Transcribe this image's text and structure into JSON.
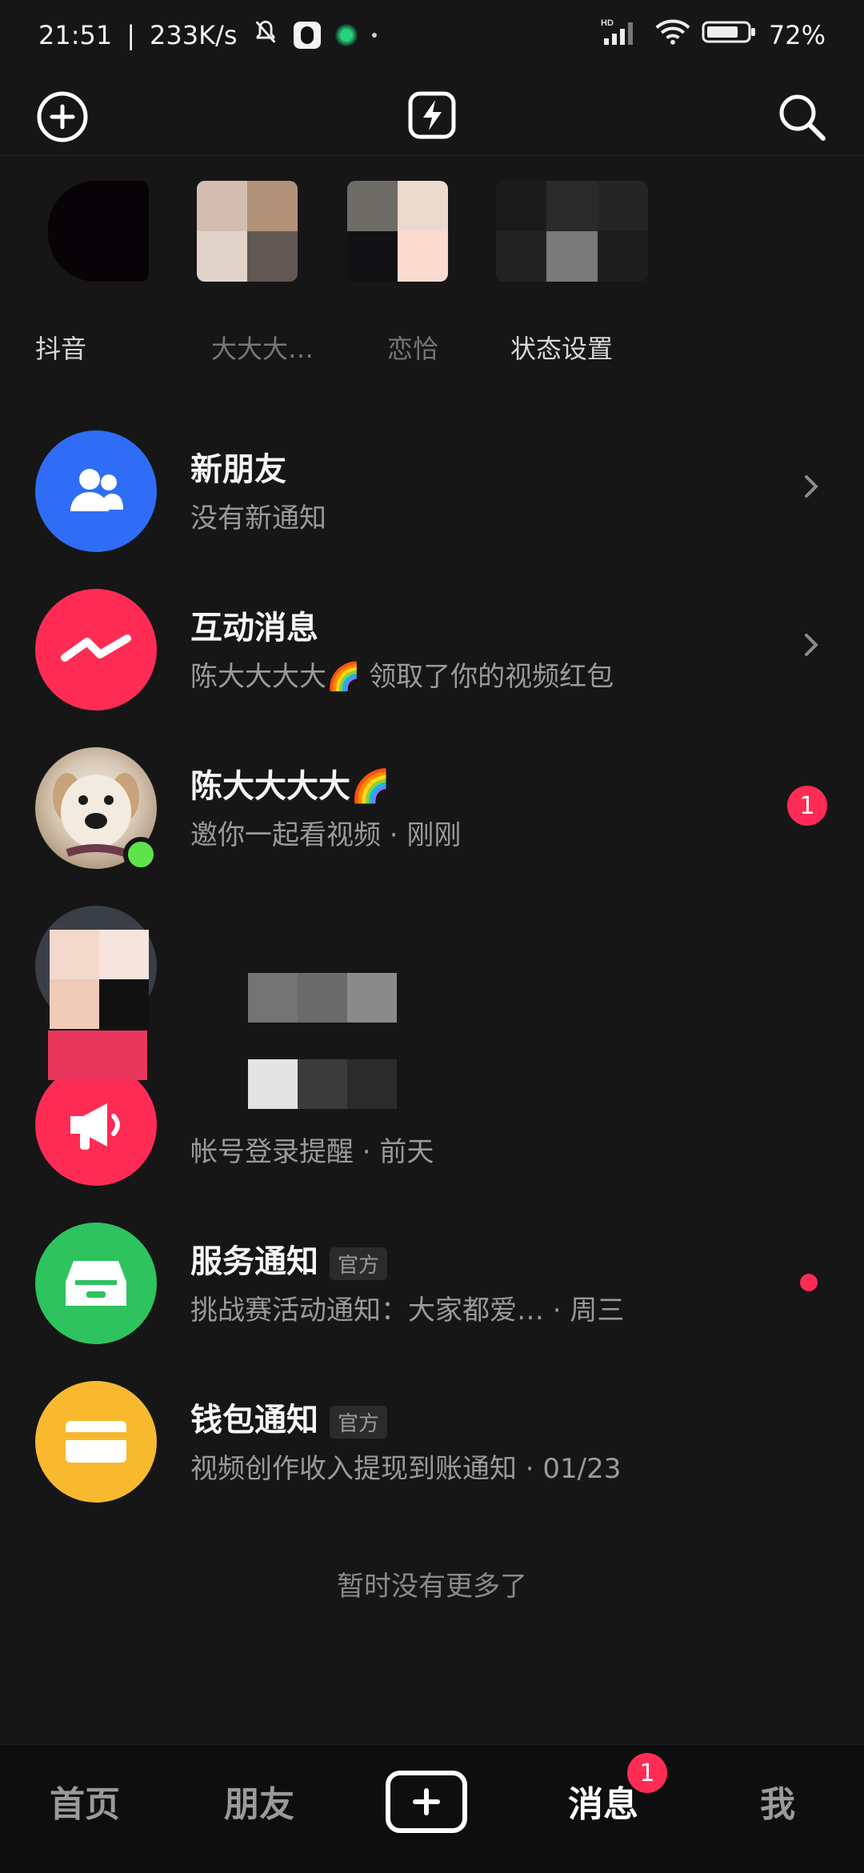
{
  "status_bar": {
    "time": "21:51",
    "network_speed": "233K/s",
    "signal_label": "HD",
    "battery": "72%",
    "icons": [
      "mute-bell-icon",
      "qq-icon",
      "app-dot-icon",
      "signal-icon",
      "wifi-icon",
      "battery-icon"
    ]
  },
  "top_bar": {
    "icons": [
      "add-icon",
      "flash-icon",
      "search-icon"
    ]
  },
  "stories": [
    {
      "label": "抖音"
    },
    {
      "label": "大大大…"
    },
    {
      "label": "恋恰"
    },
    {
      "label": "状态设置"
    }
  ],
  "messages": [
    {
      "title": "新朋友",
      "subtitle": "没有新通知",
      "icon": "friends-icon",
      "color": "#2f6df6"
    },
    {
      "title": "互动消息",
      "subtitle": "陈大大大大🌈 领取了你的视频红包",
      "icon": "lightning-wave-icon",
      "color": "#fe2c55"
    },
    {
      "title": "陈大大大大🌈",
      "subtitle": "邀你一起看视频 · 刚刚",
      "badge": "1",
      "online": true
    },
    {
      "title": "",
      "subtitle": ""
    },
    {
      "title": "",
      "subtitle": "帐号登录提醒 · 前天",
      "icon": "megaphone-icon",
      "color": "#fe2c55"
    },
    {
      "title": "服务通知",
      "tag": "官方",
      "subtitle": "挑战赛活动通知：大家都爱… · 周三",
      "icon": "inbox-icon",
      "color": "#2ec35f",
      "unread_dot": true
    },
    {
      "title": "钱包通知",
      "tag": "官方",
      "subtitle": "视频创作收入提现到账通知 · 01/23",
      "icon": "card-icon",
      "color": "#f9b92f"
    }
  ],
  "end_text": "暂时没有更多了",
  "bottom_nav": {
    "items": [
      "首页",
      "朋友",
      "消息",
      "我"
    ],
    "active": "消息",
    "messages_badge": "1"
  }
}
